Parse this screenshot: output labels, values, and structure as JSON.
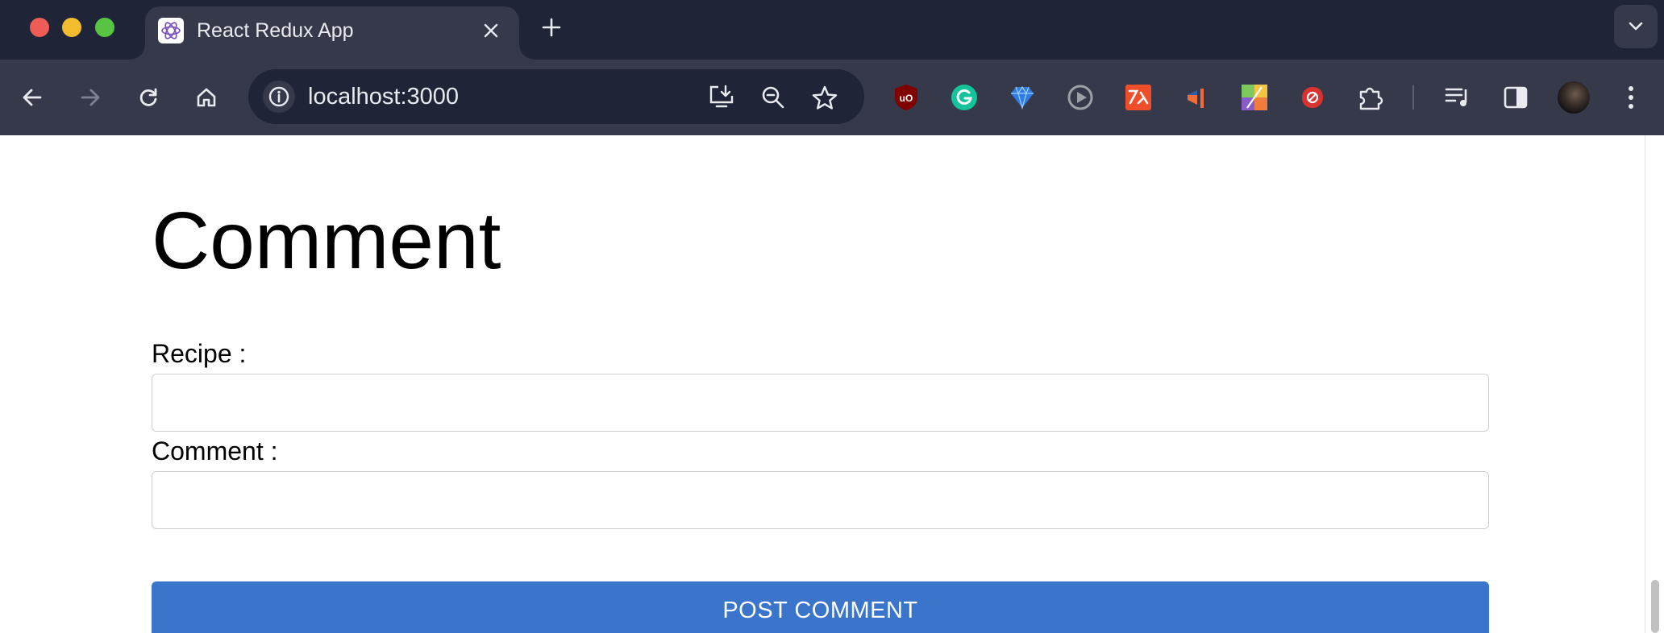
{
  "browser": {
    "tab": {
      "title": "React Redux App",
      "favicon": "react-redux-icon"
    },
    "address": {
      "url": "localhost:3000"
    },
    "nav_icons": [
      "back-arrow-icon",
      "forward-arrow-icon",
      "reload-icon",
      "home-icon"
    ],
    "omnibox_icons": [
      "install-app-icon",
      "zoom-icon",
      "bookmark-star-icon"
    ],
    "extensions": [
      {
        "name": "ublock-origin-icon",
        "label": "uO",
        "color": "#800000"
      },
      {
        "name": "grammarly-icon",
        "label": "G",
        "color": "#15c39a"
      },
      {
        "name": "gem-icon",
        "color": "#2f7de1"
      },
      {
        "name": "play-circle-icon",
        "color": "#9aa0a6"
      },
      {
        "name": "translate-icon",
        "color": "#ee4f2a"
      },
      {
        "name": "figma-like-icon",
        "color": "#f26b3a"
      },
      {
        "name": "color-palette-icon",
        "color": "#7ec95c"
      },
      {
        "name": "block-icon",
        "color": "#d9322f"
      },
      {
        "name": "extensions-puzzle-icon",
        "color": "#c9ccd3"
      }
    ]
  },
  "page": {
    "heading": "Comment",
    "form": {
      "recipe_label": "Recipe :",
      "recipe_value": "",
      "comment_label": "Comment :",
      "comment_value": "",
      "submit_label": "POST COMMENT"
    }
  },
  "colors": {
    "primary_button": "#3a75cb",
    "chrome_dark": "#1f2536",
    "chrome_toolbar": "#35394a"
  }
}
